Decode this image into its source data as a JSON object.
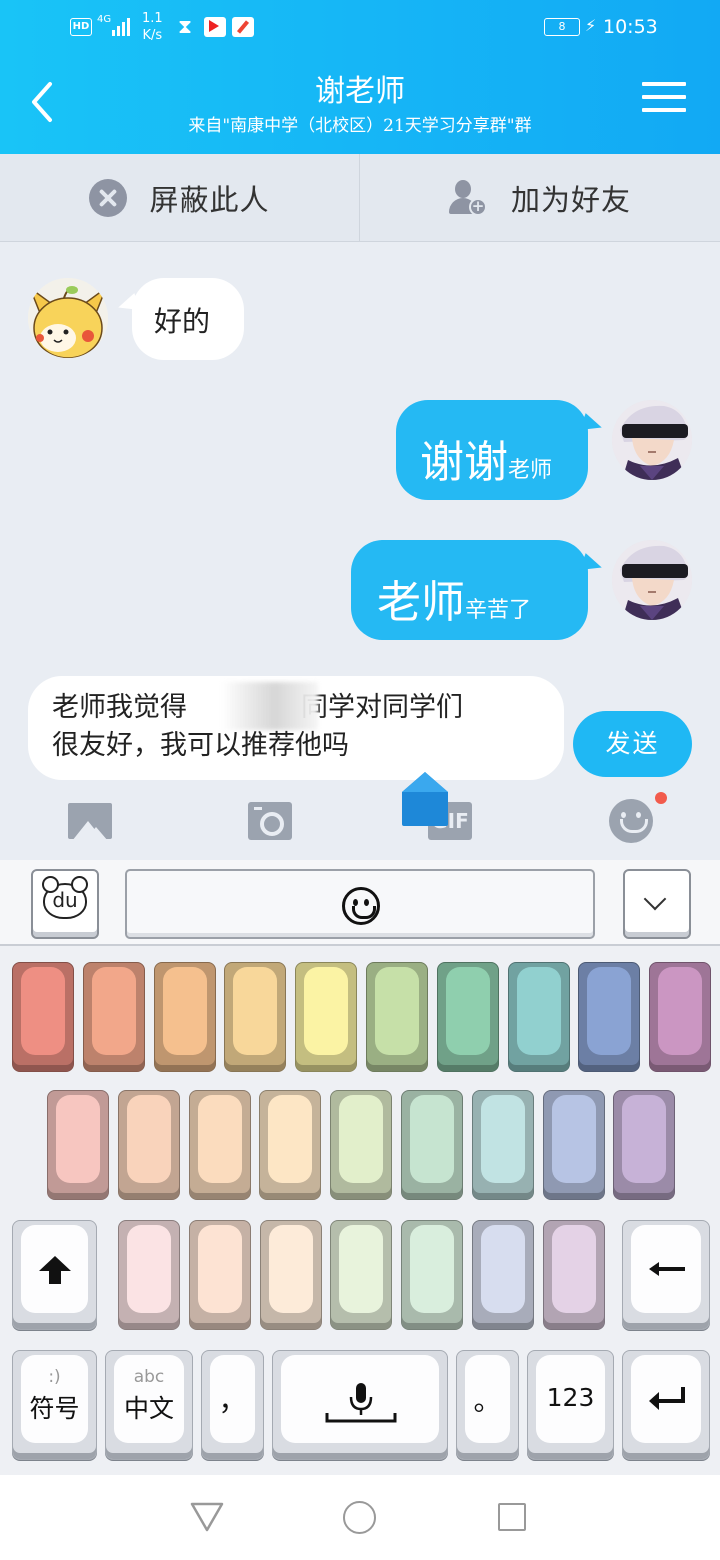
{
  "status_bar": {
    "hd": "HD",
    "network": "4G",
    "speed_value": "1.1",
    "speed_unit": "K/s",
    "battery": "8",
    "time": "10:53"
  },
  "header": {
    "back_icon": "chevron-left-icon",
    "title": "谢老师",
    "subtitle": "来自\"南康中学（北校区）21天学习分享群\"群",
    "menu_icon": "hamburger-menu-icon"
  },
  "actions": {
    "block_label": "屏蔽此人",
    "add_friend_label": "加为好友"
  },
  "messages": [
    {
      "side": "incoming",
      "text": "好的"
    },
    {
      "side": "outgoing",
      "big": "谢谢",
      "small": "老师"
    },
    {
      "side": "outgoing",
      "big": "老师",
      "small": "辛苦了"
    }
  ],
  "composer": {
    "line1_start": "老师我觉得",
    "line1_end": "同学对同学们",
    "line2": "很友好，我可以推荐他吗",
    "send_label": "发送",
    "gif_label": "GIF"
  },
  "keyboard": {
    "logo": "du",
    "row1_colors": [
      "#ee8f83",
      "#f2a78a",
      "#f5c08e",
      "#f8d79a",
      "#fbf3a4",
      "#c6e0a8",
      "#8fcfae",
      "#91d0cf",
      "#8aa3d3",
      "#cb96c2"
    ],
    "row2_colors": [
      "#f7c6c0",
      "#f9d3bb",
      "#fbdcbe",
      "#fde6c5",
      "#e2efcb",
      "#c6e4d0",
      "#c1e3e3",
      "#b7c4e4",
      "#c7b2d7"
    ],
    "row3_colors": [
      "#fbe3e4",
      "#fde3d3",
      "#fdebd9",
      "#e8f3dc",
      "#d9eedd",
      "#d7ddef",
      "#e4d2e6"
    ],
    "symbol_hint": ":)",
    "symbol_label": "符号",
    "lang_hint": "abc",
    "lang_label": "中文",
    "comma": "，",
    "period": "。",
    "numbers_label": "123"
  }
}
